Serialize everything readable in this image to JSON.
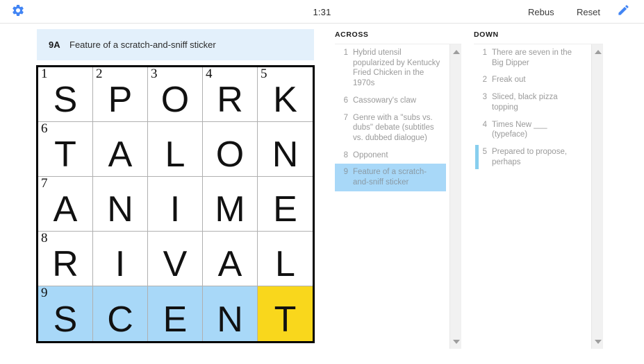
{
  "topbar": {
    "gear_icon": "gear-icon",
    "timer": "1:31",
    "rebus_label": "Rebus",
    "reset_label": "Reset",
    "pencil_icon": "pencil-icon",
    "accent_color": "#4285f4"
  },
  "current_clue": {
    "number": "9A",
    "text": "Feature of a scratch-and-sniff sticker"
  },
  "grid": {
    "rows": 5,
    "cols": 5,
    "highlight_color": "#a8d8f8",
    "cursor_color": "#f9d71c",
    "cells": [
      {
        "num": "1",
        "letter": "S",
        "state": "normal"
      },
      {
        "num": "2",
        "letter": "P",
        "state": "normal"
      },
      {
        "num": "3",
        "letter": "O",
        "state": "normal"
      },
      {
        "num": "4",
        "letter": "R",
        "state": "normal"
      },
      {
        "num": "5",
        "letter": "K",
        "state": "normal"
      },
      {
        "num": "6",
        "letter": "T",
        "state": "normal"
      },
      {
        "num": "",
        "letter": "A",
        "state": "normal"
      },
      {
        "num": "",
        "letter": "L",
        "state": "normal"
      },
      {
        "num": "",
        "letter": "O",
        "state": "normal"
      },
      {
        "num": "",
        "letter": "N",
        "state": "normal"
      },
      {
        "num": "7",
        "letter": "A",
        "state": "normal"
      },
      {
        "num": "",
        "letter": "N",
        "state": "normal"
      },
      {
        "num": "",
        "letter": "I",
        "state": "normal"
      },
      {
        "num": "",
        "letter": "M",
        "state": "normal"
      },
      {
        "num": "",
        "letter": "E",
        "state": "normal"
      },
      {
        "num": "8",
        "letter": "R",
        "state": "normal"
      },
      {
        "num": "",
        "letter": "I",
        "state": "normal"
      },
      {
        "num": "",
        "letter": "V",
        "state": "normal"
      },
      {
        "num": "",
        "letter": "A",
        "state": "normal"
      },
      {
        "num": "",
        "letter": "L",
        "state": "normal"
      },
      {
        "num": "9",
        "letter": "S",
        "state": "highlight"
      },
      {
        "num": "",
        "letter": "C",
        "state": "highlight"
      },
      {
        "num": "",
        "letter": "E",
        "state": "highlight"
      },
      {
        "num": "",
        "letter": "N",
        "state": "highlight"
      },
      {
        "num": "",
        "letter": "T",
        "state": "cursor"
      }
    ]
  },
  "across": {
    "header": "ACROSS",
    "clues": [
      {
        "num": "1",
        "text": "Hybrid utensil popularized by Kentucky Fried Chicken in the 1970s",
        "state": "normal"
      },
      {
        "num": "6",
        "text": "Cassowary's claw",
        "state": "normal"
      },
      {
        "num": "7",
        "text": "Genre with a \"subs vs. dubs\" debate (subtitles vs. dubbed dialogue)",
        "state": "normal"
      },
      {
        "num": "8",
        "text": "Opponent",
        "state": "normal"
      },
      {
        "num": "9",
        "text": "Feature of a scratch-and-sniff sticker",
        "state": "active"
      }
    ]
  },
  "down": {
    "header": "DOWN",
    "clues": [
      {
        "num": "1",
        "text": "There are seven in the Big Dipper",
        "state": "normal"
      },
      {
        "num": "2",
        "text": "Freak out",
        "state": "normal"
      },
      {
        "num": "3",
        "text": "Sliced, black pizza topping",
        "state": "normal"
      },
      {
        "num": "4",
        "text": "Times New ___ (typeface)",
        "state": "normal"
      },
      {
        "num": "5",
        "text": "Prepared to propose, perhaps",
        "state": "bar"
      }
    ]
  },
  "scrollbars": {
    "up_arrow_icon": "triangle-up-icon",
    "down_arrow_icon": "triangle-down-icon"
  }
}
